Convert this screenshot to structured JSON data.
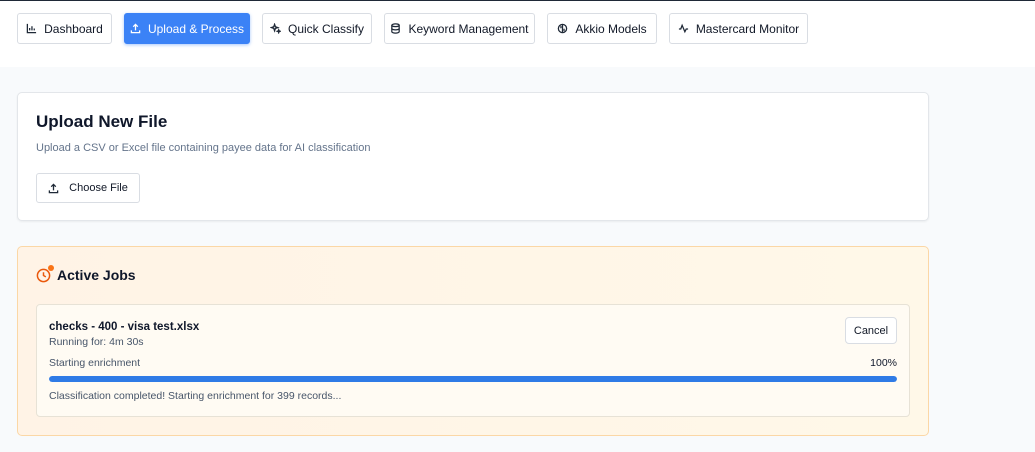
{
  "nav": {
    "items": [
      {
        "label": "Dashboard",
        "icon": "bar-chart-icon",
        "active": false
      },
      {
        "label": "Upload & Process",
        "icon": "upload-icon",
        "active": true
      },
      {
        "label": "Quick Classify",
        "icon": "sparkles-icon",
        "active": false
      },
      {
        "label": "Keyword Management",
        "icon": "database-icon",
        "active": false
      },
      {
        "label": "Akkio Models",
        "icon": "brain-icon",
        "active": false
      },
      {
        "label": "Mastercard Monitor",
        "icon": "activity-icon",
        "active": false
      }
    ]
  },
  "upload": {
    "title": "Upload New File",
    "description": "Upload a CSV or Excel file containing payee data for AI classification",
    "choose_label": "Choose File"
  },
  "jobs": {
    "title": "Active Jobs",
    "items": [
      {
        "name": "checks - 400 - visa test.xlsx",
        "running": "Running for: 4m 30s",
        "status": "Starting enrichment",
        "percent_label": "100%",
        "progress": 1.0,
        "message": "Classification completed! Starting enrichment for 399 records...",
        "cancel_label": "Cancel"
      }
    ]
  },
  "colors": {
    "accent": "#3b82f6",
    "progress": "#2f7be6",
    "jobs_border": "#fbd7a6",
    "jobs_icon": "#ea580c"
  }
}
